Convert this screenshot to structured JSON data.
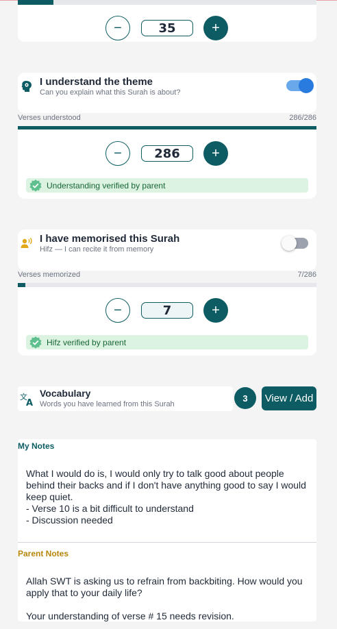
{
  "colors": {
    "primary": "#0d5c63",
    "toggle_on": "#2a7be0",
    "verified_bg": "#ddf3e2",
    "verified_text": "#166534",
    "my_notes": "#0d5c63",
    "parent_notes": "#b8860b"
  },
  "reading": {
    "progress": 0.12,
    "count": "35"
  },
  "theme": {
    "icon": "brain-head-icon",
    "title": "I understand the theme",
    "subtitle": "Can you explain what this Surah is about?",
    "toggle_on": true,
    "progress_label": "Verses understood",
    "progress_value": "286/286",
    "progress": 1.0,
    "count": "286",
    "verified_text": "Understanding verified by parent"
  },
  "hifz": {
    "icon": "speaking-person-icon",
    "title": "I have memorised this Surah",
    "subtitle": "Hifz — I can recite it from memory",
    "toggle_on": false,
    "progress_label": "Verses memorized",
    "progress_value": "7/286",
    "progress": 0.0245,
    "count": "7",
    "verified_text": "Hifz verified by parent"
  },
  "vocabulary": {
    "icon": "translate-icon",
    "title": "Vocabulary",
    "subtitle": "Words you have learned from this Surah",
    "count": "3",
    "button_label": "View / Add"
  },
  "stepper": {
    "minus": "−",
    "plus": "+"
  },
  "my_notes": {
    "heading": "My Notes",
    "text": "What I would do is, I would only try to talk good about people behind their backs and if I don't have anything good to say I would keep quiet.\n- Verse 10 is a bit difficult to understand\n- Discussion needed"
  },
  "parent_notes": {
    "heading": "Parent Notes",
    "text": "Allah SWT is asking us to refrain from backbiting. How would you apply that to your daily life?\n\nYour understanding of verse # 15 needs revision."
  }
}
